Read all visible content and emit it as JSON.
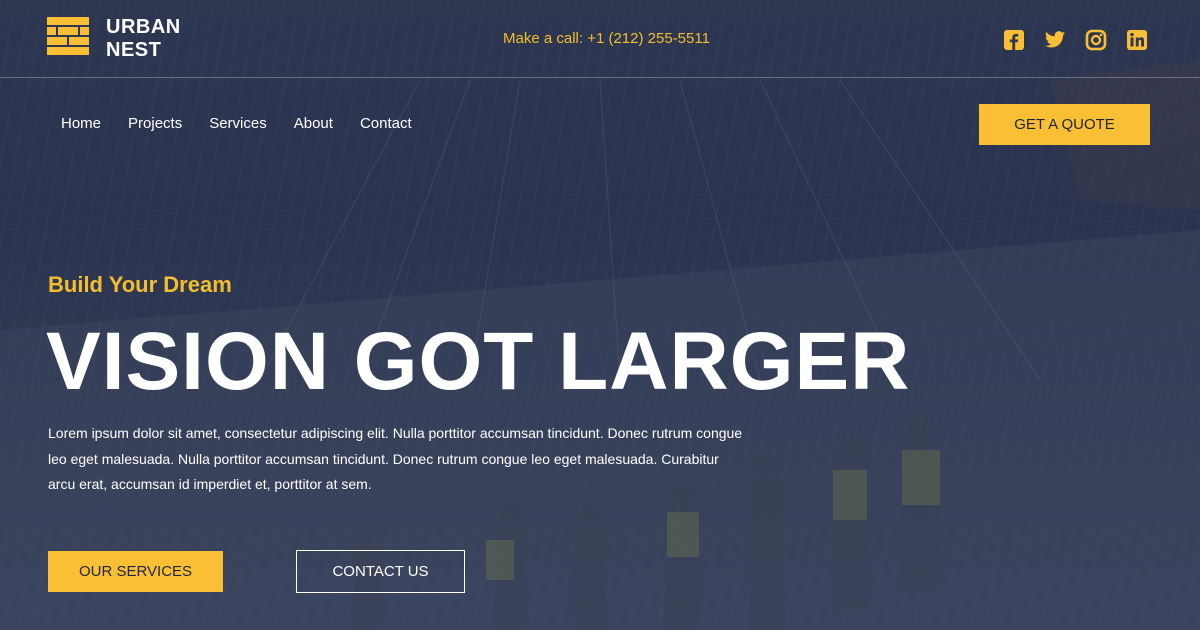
{
  "brand": {
    "line1": "URBAN",
    "line2": "NEST",
    "accent_color": "#fbbf35"
  },
  "topbar": {
    "phone_text": "Make a call: +1 (212) 255-5511",
    "socials": [
      {
        "icon": "facebook-icon"
      },
      {
        "icon": "twitter-icon"
      },
      {
        "icon": "instagram-icon"
      },
      {
        "icon": "linkedin-icon"
      }
    ]
  },
  "nav": {
    "items": [
      {
        "label": "Home"
      },
      {
        "label": "Projects"
      },
      {
        "label": "Services"
      },
      {
        "label": "About"
      },
      {
        "label": "Contact"
      }
    ]
  },
  "header": {
    "quote_button": "GET A QUOTE"
  },
  "hero": {
    "eyebrow": "Build Your Dream",
    "headline": "VISION GOT LARGER",
    "body": "Lorem ipsum dolor sit amet, consectetur adipiscing elit. Nulla porttitor accumsan tincidunt. Donec rutrum congue leo eget malesuada. Nulla porttitor accumsan tincidunt. Donec rutrum congue leo eget malesuada. Curabitur arcu erat, accumsan id imperdiet et, porttitor at sem.",
    "primary_button": "OUR SERVICES",
    "secondary_button": "CONTACT US",
    "background_image": "construction-site-workers-photo"
  },
  "colors": {
    "overlay": "#2b3550",
    "text": "#ffffff",
    "button_text": "#1e253a"
  }
}
